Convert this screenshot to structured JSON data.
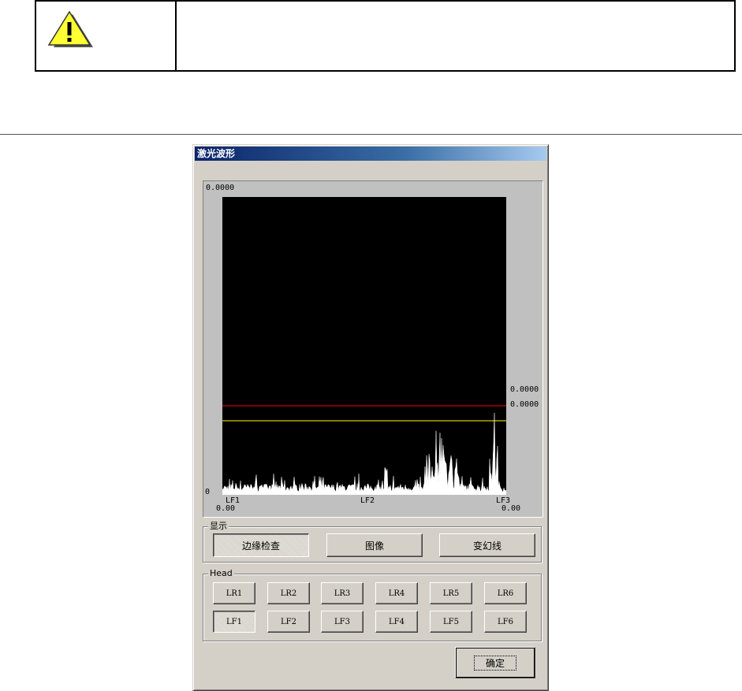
{
  "note": {
    "text": ""
  },
  "dialog": {
    "title": "激光波形",
    "graph": {
      "y_top_label": "0.0000",
      "y_zero_label": "0",
      "red_threshold_label": "0.0000",
      "yellow_threshold_label": "0.0000",
      "x_labels": [
        "LF1",
        "LF2",
        "LF3"
      ],
      "x_left_value": "0.00",
      "x_right_value": "0.00",
      "colors": {
        "background": "#000000",
        "signal": "#ffffff",
        "red_line": "#ff0000",
        "yellow_line": "#ffff00"
      }
    },
    "display_group": {
      "legend": "显示",
      "buttons": [
        "边缘检查",
        "图像",
        "变幻线"
      ]
    },
    "head_group": {
      "legend": "Head",
      "row1": [
        "LR1",
        "LR2",
        "LR3",
        "LR4",
        "LR5",
        "LR6"
      ],
      "row2": [
        "LF1",
        "LF2",
        "LF3",
        "LF4",
        "LF5",
        "LF6"
      ]
    },
    "ok_label": "确定"
  }
}
